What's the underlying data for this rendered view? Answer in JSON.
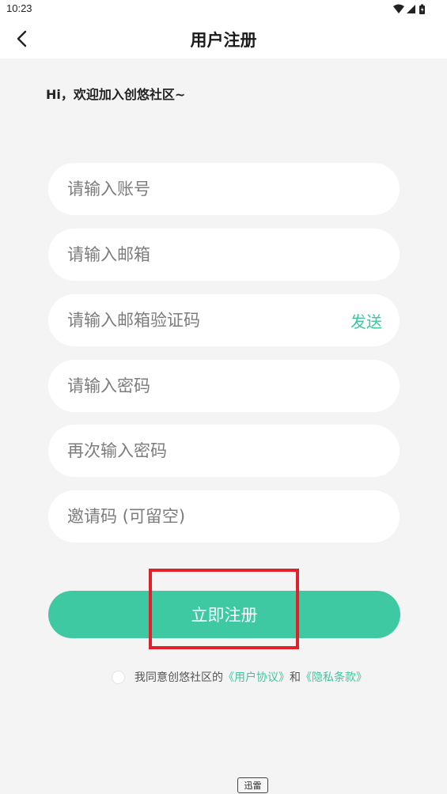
{
  "status_bar": {
    "time": "10:23",
    "icons": [
      "wifi-icon",
      "signal-icon",
      "battery-icon"
    ]
  },
  "header": {
    "title": "用户注册",
    "back_icon": "chevron-left-icon"
  },
  "welcome_text": "Hi，欢迎加入创悠社区~",
  "form": {
    "account_placeholder": "请输入账号",
    "email_placeholder": "请输入邮箱",
    "email_code_placeholder": "请输入邮箱验证码",
    "send_label": "发送",
    "password_placeholder": "请输入密码",
    "confirm_password_placeholder": "再次输入密码",
    "invite_code_placeholder": "邀请码 (可留空)"
  },
  "register_label": "立即注册",
  "agreement": {
    "prefix": "我同意创悠社区的",
    "user_agreement": "《用户协议》",
    "conjunction": "和",
    "privacy_policy": "《隐私条款》"
  },
  "bottom_tag": "迅雷",
  "colors": {
    "accent": "#3fc9a3",
    "highlight": "#e0202a",
    "background": "#f4f4f4"
  }
}
